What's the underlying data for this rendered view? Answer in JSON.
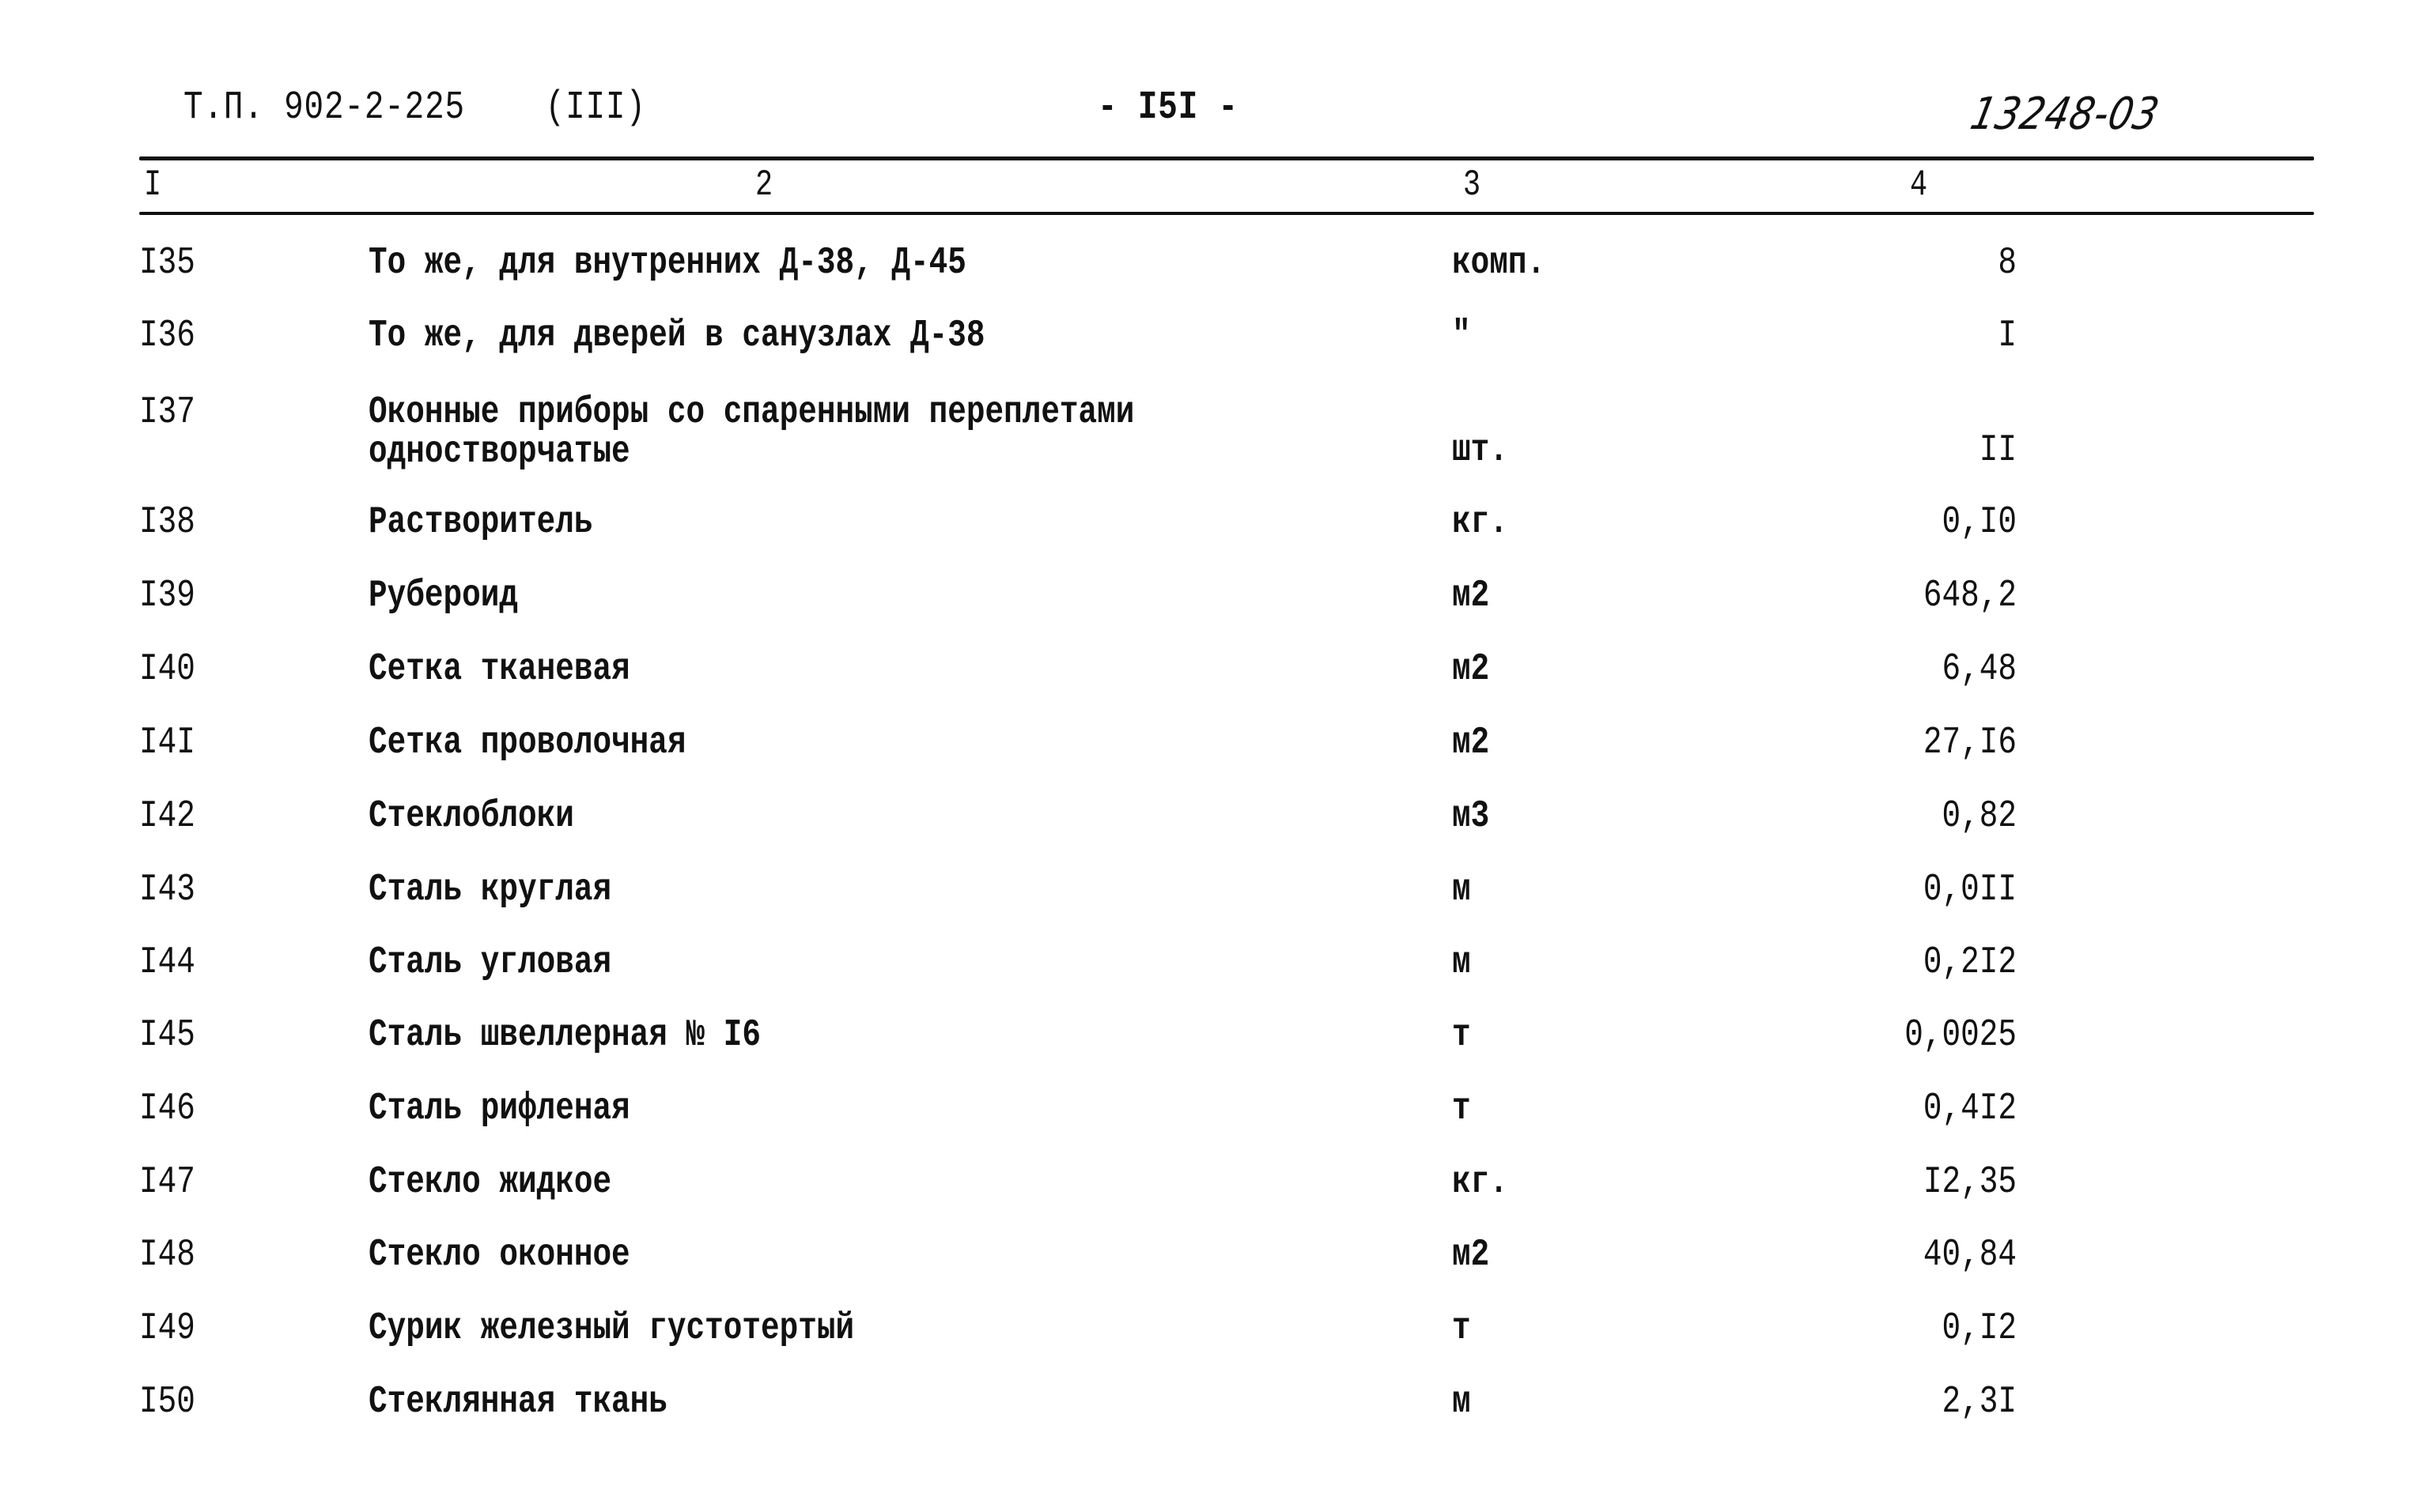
{
  "header": {
    "doc_ref": "Т.П. 902-2-225",
    "part": "(III)",
    "page_number": "- I5I -",
    "archive_number": "13248-03"
  },
  "table": {
    "column_numbers": [
      "I",
      "2",
      "3",
      "4"
    ],
    "rows": [
      {
        "num": "I35",
        "name": "То же, для внутренних Д-38, Д-45",
        "name_line2": "",
        "unit": "комп.",
        "qty": "8"
      },
      {
        "num": "I36",
        "name": "То же, для дверей в санузлах Д-38",
        "name_line2": "",
        "unit": "\"",
        "qty": "I"
      },
      {
        "num": "I37",
        "name": "Оконные приборы со спаренными переплетами",
        "name_line2": "одностворчатые",
        "unit": "шт.",
        "qty": "II"
      },
      {
        "num": "I38",
        "name": "Растворитель",
        "name_line2": "",
        "unit": "кг.",
        "qty": "0,I0"
      },
      {
        "num": "I39",
        "name": "Рубероид",
        "name_line2": "",
        "unit": "м2",
        "qty": "648,2"
      },
      {
        "num": "I40",
        "name": "Сетка тканевая",
        "name_line2": "",
        "unit": "м2",
        "qty": "6,48"
      },
      {
        "num": "I4I",
        "name": "Сетка проволочная",
        "name_line2": "",
        "unit": "м2",
        "qty": "27,I6"
      },
      {
        "num": "I42",
        "name": "Стеклоблоки",
        "name_line2": "",
        "unit": "м3",
        "qty": "0,82"
      },
      {
        "num": "I43",
        "name": "Сталь круглая",
        "name_line2": "",
        "unit": "м",
        "qty": "0,0II"
      },
      {
        "num": "I44",
        "name": "Сталь угловая",
        "name_line2": "",
        "unit": "м",
        "qty": "0,2I2"
      },
      {
        "num": "I45",
        "name": "Сталь швеллерная № I6",
        "name_line2": "",
        "unit": "т",
        "qty": "0,0025"
      },
      {
        "num": "I46",
        "name": "Сталь рифленая",
        "name_line2": "",
        "unit": "т",
        "qty": "0,4I2"
      },
      {
        "num": "I47",
        "name": "Стекло жидкое",
        "name_line2": "",
        "unit": "кг.",
        "qty": "I2,35"
      },
      {
        "num": "I48",
        "name": "Стекло оконное",
        "name_line2": "",
        "unit": "м2",
        "qty": "40,84"
      },
      {
        "num": "I49",
        "name": "Сурик железный густотертый",
        "name_line2": "",
        "unit": "т",
        "qty": "0,I2"
      },
      {
        "num": "I50",
        "name": "Стеклянная ткань",
        "name_line2": "",
        "unit": "м",
        "qty": "2,3I"
      }
    ]
  }
}
